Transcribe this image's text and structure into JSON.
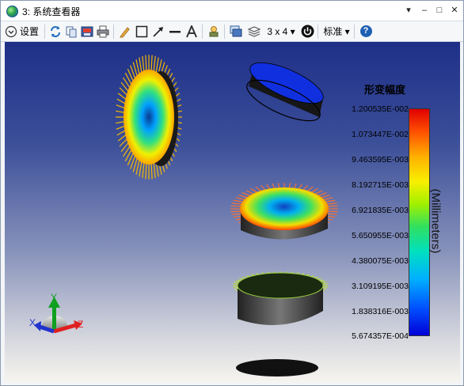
{
  "window": {
    "title": "3: 系统查看器",
    "controls": {
      "menu": "▾",
      "minimize": "–",
      "maximize": "□",
      "close": "✕"
    }
  },
  "toolbar": {
    "settings_label": "设置",
    "layout_label": "3 x 4 ▾",
    "standard_label": "标准 ▾",
    "help_label": "?"
  },
  "legend": {
    "title": "形变幅度",
    "units": "(Millimeters)",
    "ticks": [
      "1.200535E-002",
      "1.073447E-002",
      "9.463595E-003",
      "8.192715E-003",
      "6.921835E-003",
      "5.650955E-003",
      "4.380075E-003",
      "3.109195E-003",
      "1.838316E-003",
      "5.674357E-004"
    ]
  },
  "triad": {
    "x": "X",
    "y": "Y",
    "z": "Z"
  },
  "colors": {
    "accent": "#1f5fb3",
    "x_axis": "#2233cc",
    "y_axis": "#10a020",
    "z_axis": "#e02020"
  }
}
